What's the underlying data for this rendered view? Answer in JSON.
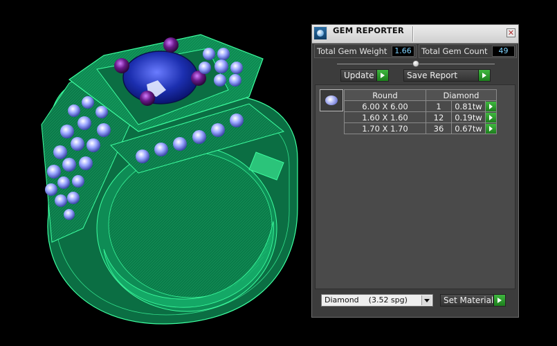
{
  "panel": {
    "title": "GEM REPORTER",
    "close_glyph": "✕",
    "stats": {
      "total_gem_weight_label": "Total Gem Weight",
      "total_gem_weight_value": "1.66",
      "total_gem_count_label": "Total Gem Count",
      "total_gem_count_value": "49"
    },
    "buttons": {
      "update_label": "Update",
      "save_report_label": "Save Report",
      "set_material_label": "Set Material"
    },
    "table": {
      "headers": [
        "Round",
        "Diamond"
      ],
      "rows": [
        {
          "size": "6.00 X 6.00",
          "count": "1",
          "weight": "0.81tw"
        },
        {
          "size": "1.60 X 1.60",
          "count": "12",
          "weight": "0.19tw"
        },
        {
          "size": "1.70 X 1.70",
          "count": "36",
          "weight": "0.67tw"
        }
      ]
    },
    "material_select": {
      "value": "Diamond    (3.52 spg)"
    }
  },
  "colors": {
    "ring_metal": "#0f8a55",
    "ring_wire": "#3dffa0",
    "center_stone": "#1c2fb0",
    "prongs": "#6a1a8a",
    "small_stones": "#9aa6ff",
    "accent_green": "#2aa52a",
    "value_text": "#7fd3ff"
  },
  "icons": {
    "app": "gem-reporter-app-icon",
    "close": "close-icon",
    "arrow": "green-play-arrow-icon",
    "dropdown": "chevron-down-icon",
    "gem_shape": "round-gem-thumbnail-icon"
  }
}
